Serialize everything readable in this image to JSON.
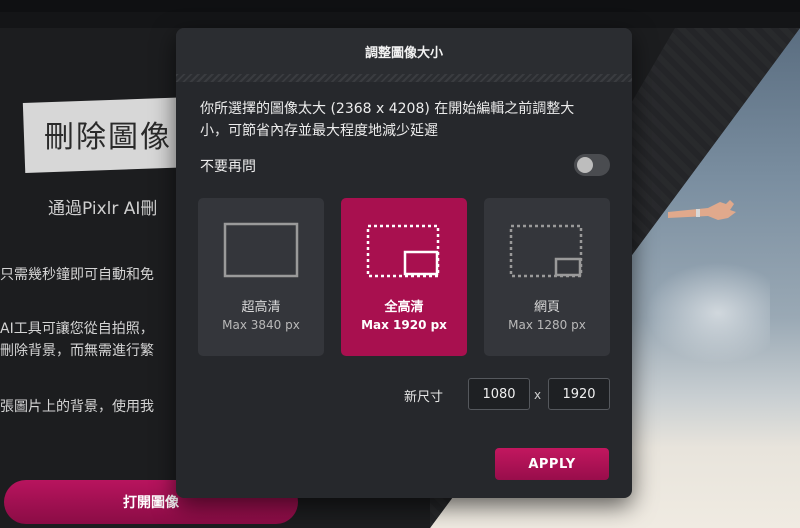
{
  "background": {
    "title": "刪除圖像",
    "subtitle": "通過Pixlr AI刪",
    "lines": [
      "只需幾秒鐘即可自動和免",
      "AI工具可讓您從自拍照，",
      "刪除背景，而無需進行繁",
      "張圖片上的背景，使用我"
    ],
    "open_button_label": "打開圖像"
  },
  "modal": {
    "title": "調整圖像大小",
    "description": "你所選擇的圖像太大 (2368 x 4208) 在開始編輯之前調整大小，可節省內存並最大程度地減少延遲",
    "dont_ask_label": "不要再問",
    "dont_ask_enabled": false,
    "options": [
      {
        "name": "超高清",
        "max": "Max 3840 px",
        "selected": false,
        "icon": "uhd-frame-icon"
      },
      {
        "name": "全高清",
        "max": "Max 1920 px",
        "selected": true,
        "icon": "fullhd-frame-icon"
      },
      {
        "name": "網頁",
        "max": "Max 1280 px",
        "selected": false,
        "icon": "web-frame-icon"
      }
    ],
    "new_size_label": "新尺寸",
    "width_value": "1080",
    "height_value": "1920",
    "times_symbol": "x",
    "apply_label": "APPLY"
  },
  "colors": {
    "accent": "#a8104f",
    "modal_bg": "#26282c",
    "card_bg": "#34363b"
  }
}
